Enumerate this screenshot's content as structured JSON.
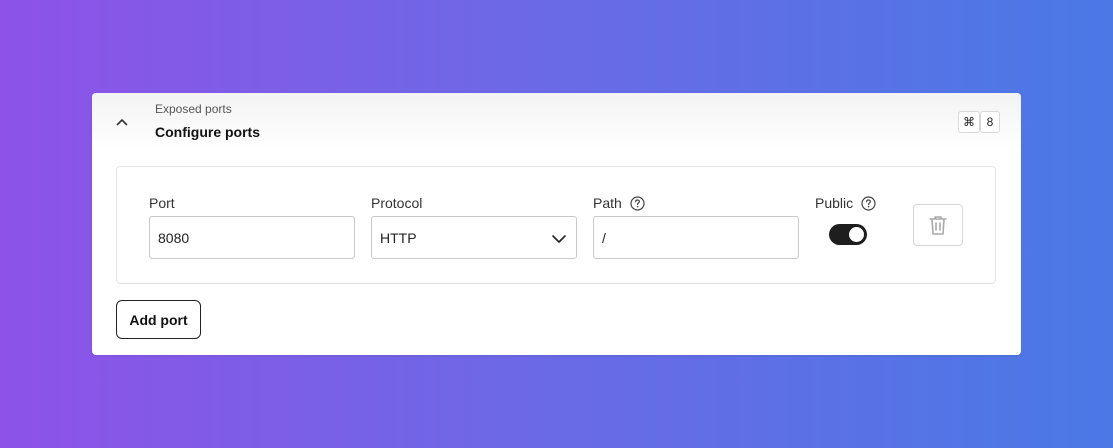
{
  "header": {
    "subtitle": "Exposed ports",
    "title": "Configure ports",
    "shortcut_modifier": "⌘",
    "shortcut_key": "8",
    "collapse_icon": "chevron-up-icon"
  },
  "port_row": {
    "port": {
      "label": "Port",
      "value": "8080"
    },
    "protocol": {
      "label": "Protocol",
      "value": "HTTP",
      "icon": "chevron-down-icon"
    },
    "path": {
      "label": "Path",
      "value": "/",
      "help_icon": "question-circle-icon"
    },
    "public": {
      "label": "Public",
      "enabled": true,
      "help_icon": "question-circle-icon"
    },
    "delete_icon": "trash-icon"
  },
  "add_port_label": "Add port",
  "colors": {
    "toggle_on": "#1e1e1e",
    "gradient_start": "#8e52e8",
    "gradient_end": "#4a79e6"
  }
}
